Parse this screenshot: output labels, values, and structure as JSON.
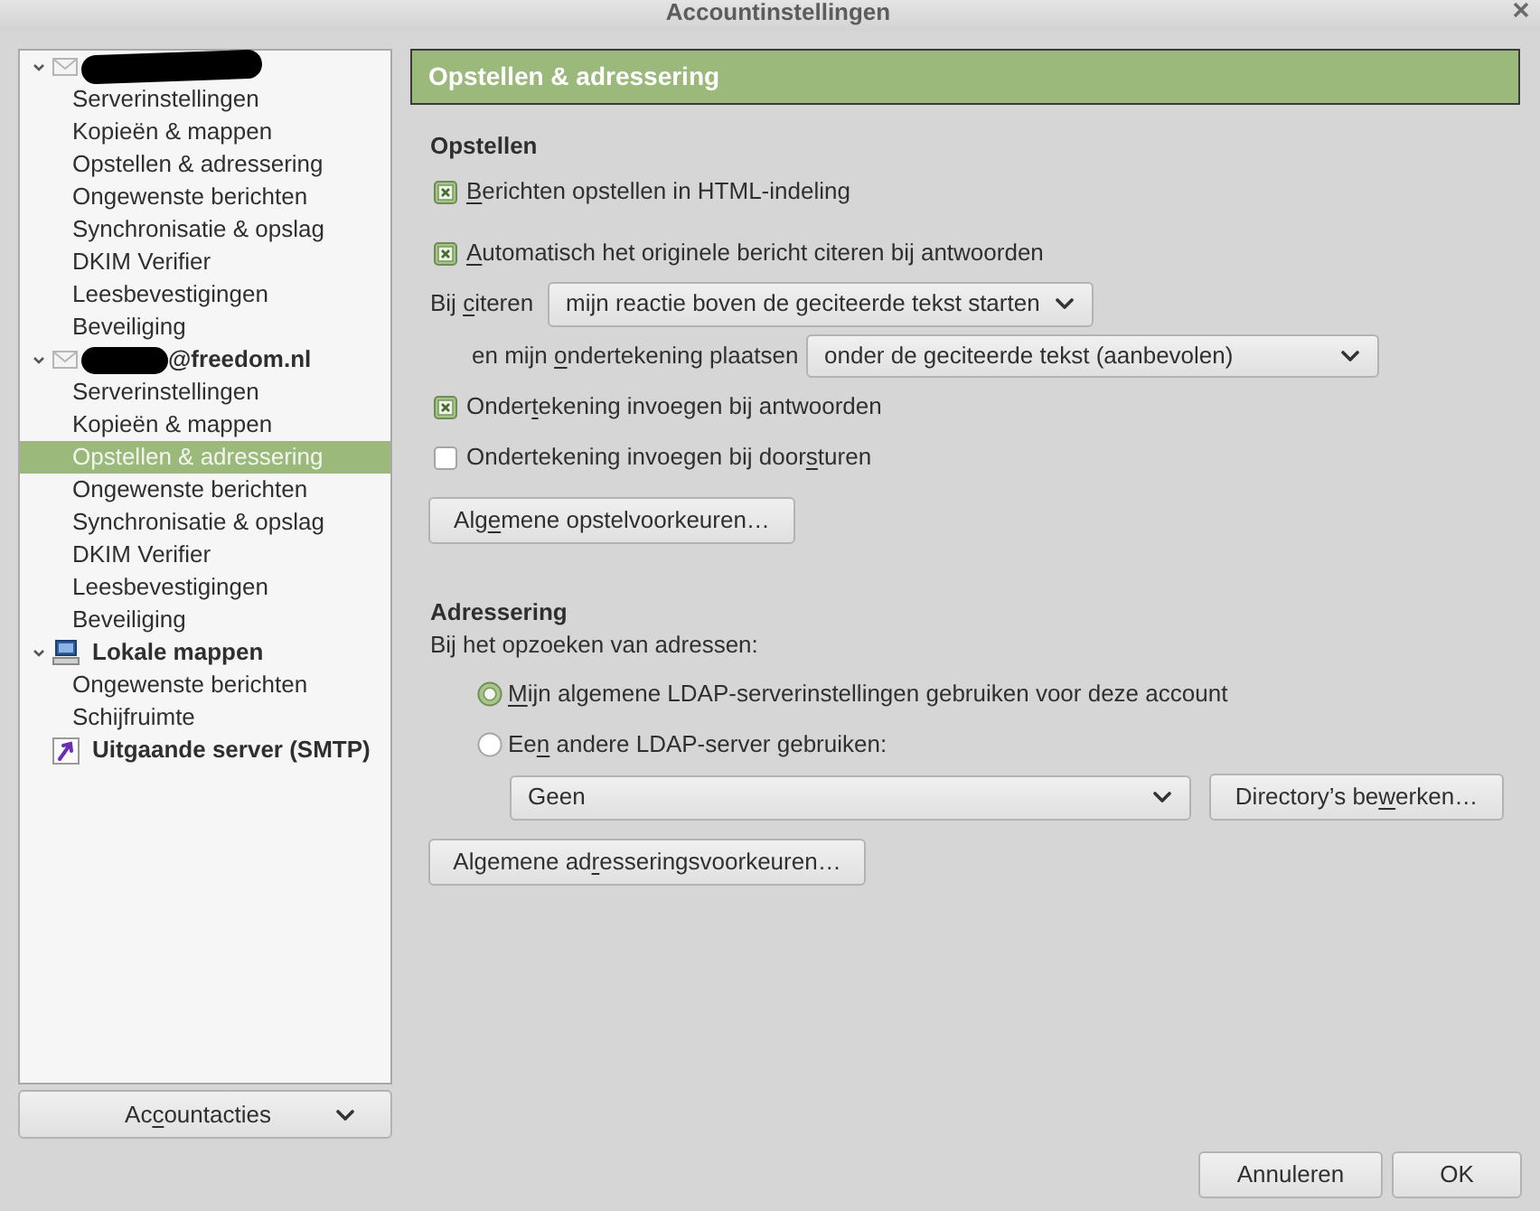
{
  "window": {
    "title": "Accountinstellingen"
  },
  "sidebar": {
    "tree": [
      {
        "kind": "mail-account",
        "redacted": true,
        "expanded": true,
        "children": [
          {
            "label": "Serverinstellingen",
            "selected": false
          },
          {
            "label": "Kopieën & mappen",
            "selected": false
          },
          {
            "label": "Opstellen & adressering",
            "selected": false
          },
          {
            "label": "Ongewenste berichten",
            "selected": false
          },
          {
            "label": "Synchronisatie & opslag",
            "selected": false
          },
          {
            "label": "DKIM Verifier",
            "selected": false
          },
          {
            "label": "Leesbevestigingen",
            "selected": false
          },
          {
            "label": "Beveiliging",
            "selected": false
          }
        ]
      },
      {
        "kind": "mail-account",
        "redacted": true,
        "label": "@freedom.nl",
        "expanded": true,
        "children": [
          {
            "label": "Serverinstellingen",
            "selected": false
          },
          {
            "label": "Kopieën & mappen",
            "selected": false
          },
          {
            "label": "Opstellen & adressering",
            "selected": true
          },
          {
            "label": "Ongewenste berichten",
            "selected": false
          },
          {
            "label": "Synchronisatie & opslag",
            "selected": false
          },
          {
            "label": "DKIM Verifier",
            "selected": false
          },
          {
            "label": "Leesbevestigingen",
            "selected": false
          },
          {
            "label": "Beveiliging",
            "selected": false
          }
        ]
      },
      {
        "kind": "local-folders",
        "label": "Lokale mappen",
        "expanded": true,
        "children": [
          {
            "label": "Ongewenste berichten",
            "selected": false
          },
          {
            "label": "Schijfruimte",
            "selected": false
          }
        ]
      },
      {
        "kind": "outgoing-server",
        "label": "Uitgaande server (SMTP)"
      }
    ],
    "actions_button": {
      "label": {
        "before": "Ac",
        "underlined": "c",
        "after": "ountacties"
      }
    }
  },
  "panel": {
    "title": "Opstellen & adressering",
    "compose": {
      "heading": "Opstellen",
      "rows": [
        {
          "kind": "checkbox",
          "label": {
            "underlined": "B",
            "after": "erichten opstellen in HTML-indeling"
          },
          "checked": true
        },
        {
          "kind": "checkbox",
          "label": {
            "underlined": "A",
            "after": "utomatisch het originele bericht citeren bij antwoorden"
          },
          "checked": true
        },
        {
          "kind": "select",
          "label": {
            "before": "Bij ",
            "underlined": "c",
            "after": "iteren"
          },
          "value": "mijn reactie boven de geciteerde tekst starten",
          "children": [
            {
              "kind": "select",
              "label": {
                "before": "en mijn ",
                "underlined": "o",
                "after": "ndertekening plaatsen"
              },
              "value": "onder de geciteerde tekst (aanbevolen)"
            }
          ]
        },
        {
          "kind": "checkbox",
          "label": {
            "before": "Onder",
            "underlined": "t",
            "after": "ekening invoegen bij antwoorden"
          },
          "checked": true
        },
        {
          "kind": "checkbox",
          "label": {
            "before": "Ondertekening invoegen bij door",
            "underlined": "s",
            "after": "turen"
          },
          "checked": false
        },
        {
          "kind": "button",
          "label": {
            "before": "Alg",
            "underlined": "e",
            "after": "mene opstelvoorkeuren…"
          }
        }
      ]
    },
    "addressing": {
      "heading": "Adressering",
      "intro": "Bij het opzoeken van adressen:",
      "options": [
        {
          "label": {
            "underlined": "M",
            "after": "ijn algemene LDAP-serverinstellingen gebruiken voor deze account"
          },
          "selected": true
        },
        {
          "label": {
            "before": "Ee",
            "underlined": "n",
            "after": " andere LDAP-server gebruiken:"
          },
          "selected": false
        }
      ],
      "directory_select": {
        "value": "Geen"
      },
      "edit_button": {
        "label": {
          "before": "Directory’s be",
          "underlined": "w",
          "after": "erken…"
        }
      },
      "prefs_button": {
        "label": {
          "before": "Algemene ad",
          "underlined": "r",
          "after": "esseringsvoorkeuren…"
        }
      }
    }
  },
  "dialog_buttons": [
    {
      "label": "Annuleren"
    },
    {
      "label": "OK"
    }
  ]
}
